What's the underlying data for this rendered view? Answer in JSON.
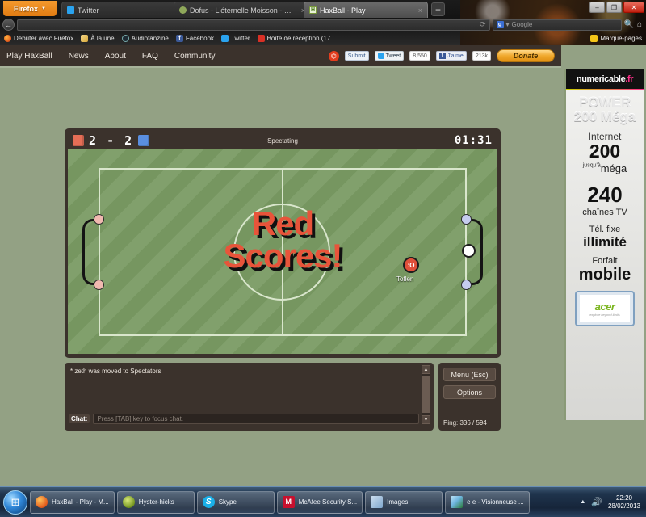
{
  "browser": {
    "firefox_button": "Firefox",
    "tabs": [
      {
        "title": "Twitter",
        "favicon": "twitter-icon",
        "active": false
      },
      {
        "title": "Dofus - L'éternelle Moisson - Capture...",
        "favicon": "dofus-icon",
        "active": false
      },
      {
        "title": "HaxBall - Play",
        "favicon": "haxball-icon",
        "active": true
      }
    ],
    "new_tab_label": "+",
    "window_controls": {
      "minimize": "–",
      "maximize": "❐",
      "close": "✕"
    },
    "nav": {
      "back_icon": "back-arrow-icon",
      "url_value": "",
      "reload_icon": "reload-icon",
      "search_engine": "Google",
      "search_placeholder": "Google",
      "magnifier_icon": "search-icon",
      "home_icon": "home-icon"
    },
    "bookmarks": [
      {
        "label": "Débuter avec Firefox",
        "icon": "firefox-icon"
      },
      {
        "label": "À la une",
        "icon": "page-icon"
      },
      {
        "label": "Audiofanzine",
        "icon": "audiofanzine-icon"
      },
      {
        "label": "Facebook",
        "icon": "facebook-icon"
      },
      {
        "label": "Twitter",
        "icon": "twitter-icon"
      },
      {
        "label": "Boîte de réception (17...",
        "icon": "mail-icon"
      }
    ],
    "bookmarks_right": {
      "label": "Marque-pages",
      "icon": "star-icon"
    }
  },
  "site": {
    "nav_links": [
      "Play HaxBall",
      "News",
      "About",
      "FAQ",
      "Community"
    ],
    "social": {
      "reddit_icon": "reddit-icon",
      "submit_label": "Submit",
      "tweet_label": "Tweet",
      "tweet_count": "8,550",
      "facebook_label": "J'aime",
      "facebook_count": "213k",
      "donate_label": "Donate"
    }
  },
  "game": {
    "scoreboard": {
      "red_score": "2",
      "separator": "-",
      "blue_score": "2",
      "status": "Spectating",
      "timer": "01:31",
      "red_color": "#e56e56",
      "blue_color": "#5a8fe0"
    },
    "announcement_line1": "Red",
    "announcement_line2": "Scores!",
    "announcement_color": "#e8543a",
    "players": [
      {
        "name": "Toflen",
        "avatar": ":O",
        "team": "red"
      }
    ],
    "field_color": "#7a9b63",
    "line_color": "#d9e6cc"
  },
  "chat": {
    "messages": [
      "* zeth was moved to Spectators"
    ],
    "input_label": "Chat:",
    "input_value": "",
    "input_placeholder": "Press [TAB] key to focus chat.",
    "scroll_up_icon": "triangle-up-icon",
    "scroll_down_icon": "triangle-down-icon"
  },
  "controls": {
    "menu_label": "Menu (Esc)",
    "options_label": "Options",
    "ping_label": "Ping: 336 / 594"
  },
  "ad": {
    "brand": "numericable",
    "brand_dot": ".fr",
    "headline1": "POWER",
    "headline2": "200 Méga",
    "line_internet": "Internet",
    "speed_value": "200",
    "speed_sup": "jusqu'à",
    "speed_unit": "méga",
    "channels_value": "240",
    "channels_label": "chaînes TV",
    "phone_label": "Tél. fixe",
    "phone_value": "illimité",
    "mobile_label": "Forfait",
    "mobile_value": "mobile",
    "device_brand": "acer",
    "device_tagline": "explore beyond limits"
  },
  "taskbar": {
    "start_icon": "windows-start-icon",
    "items": [
      {
        "label": "HaxBall - Play - M...",
        "icon": "firefox-icon"
      },
      {
        "label": "Hyster-hicks",
        "icon": "hyster-icon"
      },
      {
        "label": "Skype",
        "icon": "skype-icon"
      },
      {
        "label": "McAfee Security S...",
        "icon": "mcafee-icon"
      },
      {
        "label": "Images",
        "icon": "images-icon"
      },
      {
        "label": "e e - Visionneuse ...",
        "icon": "photo-viewer-icon"
      }
    ],
    "tray": {
      "arrow_icon": "chevron-up-icon",
      "speaker_icon": "speaker-icon"
    },
    "clock_time": "22:20",
    "clock_date": "28/02/2013"
  }
}
